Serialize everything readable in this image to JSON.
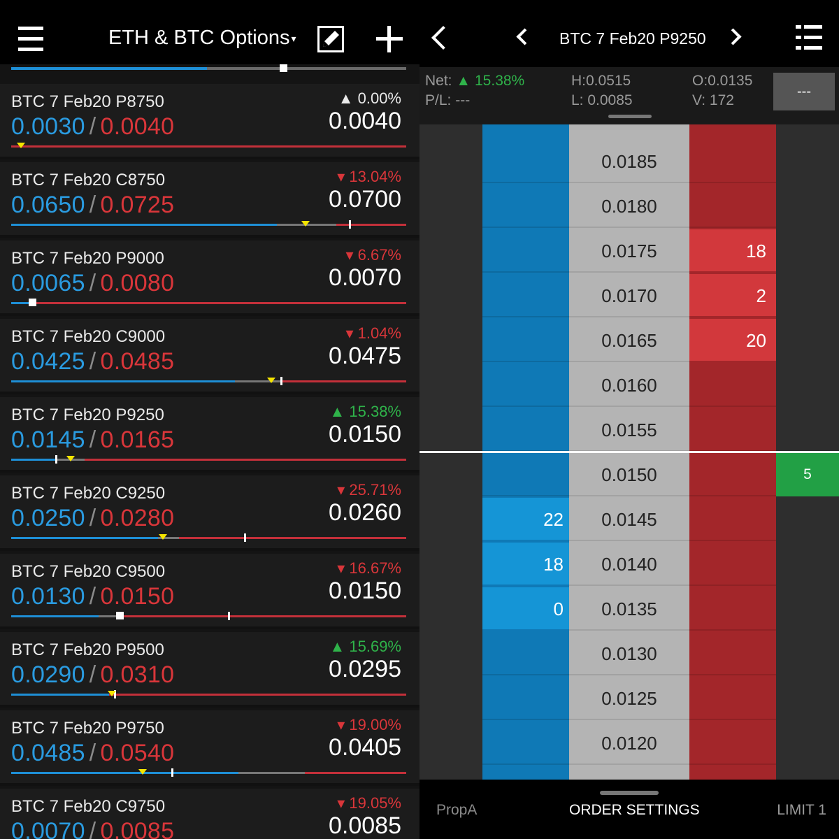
{
  "left_panel": {
    "header": {
      "title": "ETH & BTC Options",
      "caret": "▾",
      "menu_icon": "hamburger-menu-icon",
      "edit_icon": "edit-icon",
      "add_icon": "plus-icon"
    },
    "colors": {
      "bid": "#2a9be0",
      "ask": "#d9363a",
      "up": "#2fb34a",
      "down": "#d9363a"
    },
    "instruments": [
      {
        "name": "BTC 7 Feb20 P8750",
        "bid": "0.0030",
        "sep": "/",
        "ask": "0.0040",
        "change": "▲ 0.00%",
        "direction": "flat",
        "last": "0.0040"
      },
      {
        "name": "BTC 7 Feb20 C8750",
        "bid": "0.0650",
        "sep": "/",
        "ask": "0.0725",
        "change": "▾ 13.04%",
        "direction": "down",
        "last": "0.0700"
      },
      {
        "name": "BTC 7 Feb20 P9000",
        "bid": "0.0065",
        "sep": "/",
        "ask": "0.0080",
        "change": "▾ 6.67%",
        "direction": "down",
        "last": "0.0070"
      },
      {
        "name": "BTC 7 Feb20 C9000",
        "bid": "0.0425",
        "sep": "/",
        "ask": "0.0485",
        "change": "▾ 1.04%",
        "direction": "down",
        "last": "0.0475"
      },
      {
        "name": "BTC 7 Feb20 P9250",
        "bid": "0.0145",
        "sep": "/",
        "ask": "0.0165",
        "change": "▲ 15.38%",
        "direction": "up",
        "last": "0.0150"
      },
      {
        "name": "BTC 7 Feb20 C9250",
        "bid": "0.0250",
        "sep": "/",
        "ask": "0.0280",
        "change": "▾ 25.71%",
        "direction": "down",
        "last": "0.0260"
      },
      {
        "name": "BTC 7 Feb20 C9500",
        "bid": "0.0130",
        "sep": "/",
        "ask": "0.0150",
        "change": "▾ 16.67%",
        "direction": "down",
        "last": "0.0150"
      },
      {
        "name": "BTC 7 Feb20 P9500",
        "bid": "0.0290",
        "sep": "/",
        "ask": "0.0310",
        "change": "▲ 15.69%",
        "direction": "up",
        "last": "0.0295"
      },
      {
        "name": "BTC 7 Feb20 P9750",
        "bid": "0.0485",
        "sep": "/",
        "ask": "0.0540",
        "change": "▾ 19.00%",
        "direction": "down",
        "last": "0.0405"
      },
      {
        "name": "BTC 7 Feb20 C9750",
        "bid": "0.0070",
        "sep": "/",
        "ask": "0.0085",
        "change": "▾ 19.05%",
        "direction": "down",
        "last": "0.0085"
      }
    ]
  },
  "right_panel": {
    "header": {
      "title": "BTC 7 Feb20 P9250",
      "back_icon": "back-chevron-icon",
      "prev_icon": "prev-chevron-icon",
      "next_icon": "next-chevron-icon",
      "list_icon": "list-icon"
    },
    "stats": {
      "net_label": "Net:",
      "net_arrow": "▲",
      "net_value": "15.38%",
      "pl_label": "P/L:",
      "pl_value": "---",
      "high_label": "H:",
      "high_value": "0.0515",
      "low_label": "L:",
      "low_value": "0.0085",
      "open_label": "O:",
      "open_value": "0.0135",
      "volume_label": "V:",
      "volume_value": "172",
      "position_button": "---"
    },
    "ladder": [
      {
        "price": "0.0185",
        "bid_qty": "",
        "ask_qty": "",
        "trade_qty": ""
      },
      {
        "price": "0.0180",
        "bid_qty": "",
        "ask_qty": "",
        "trade_qty": ""
      },
      {
        "price": "0.0175",
        "bid_qty": "",
        "ask_qty": "18",
        "trade_qty": ""
      },
      {
        "price": "0.0170",
        "bid_qty": "",
        "ask_qty": "2",
        "trade_qty": ""
      },
      {
        "price": "0.0165",
        "bid_qty": "",
        "ask_qty": "20",
        "trade_qty": ""
      },
      {
        "price": "0.0160",
        "bid_qty": "",
        "ask_qty": "",
        "trade_qty": ""
      },
      {
        "price": "0.0155",
        "bid_qty": "",
        "ask_qty": "",
        "trade_qty": ""
      },
      {
        "price": "0.0150",
        "bid_qty": "",
        "ask_qty": "",
        "trade_qty": "5"
      },
      {
        "price": "0.0145",
        "bid_qty": "22",
        "ask_qty": "",
        "trade_qty": ""
      },
      {
        "price": "0.0140",
        "bid_qty": "18",
        "ask_qty": "",
        "trade_qty": ""
      },
      {
        "price": "0.0135",
        "bid_qty": "0",
        "ask_qty": "",
        "trade_qty": ""
      },
      {
        "price": "0.0130",
        "bid_qty": "",
        "ask_qty": "",
        "trade_qty": ""
      },
      {
        "price": "0.0125",
        "bid_qty": "",
        "ask_qty": "",
        "trade_qty": ""
      },
      {
        "price": "0.0120",
        "bid_qty": "",
        "ask_qty": "",
        "trade_qty": ""
      }
    ],
    "footer": {
      "account": "PropA",
      "settings": "ORDER SETTINGS",
      "order_type": "LIMIT 1"
    }
  }
}
